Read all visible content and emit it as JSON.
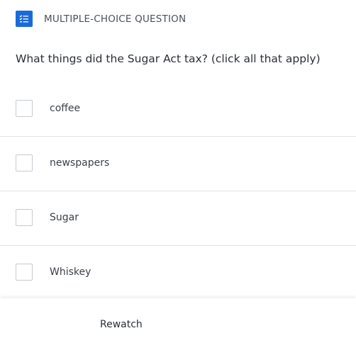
{
  "header": {
    "type_label": "MULTIPLE-CHOICE QUESTION",
    "icon": "checklist-icon",
    "accent_color": "#1a6bd8"
  },
  "question": {
    "text": "What things did the Sugar Act tax? (click all that apply)"
  },
  "options": [
    {
      "label": "coffee",
      "checked": false
    },
    {
      "label": "newspapers",
      "checked": false
    },
    {
      "label": "Sugar",
      "checked": false
    },
    {
      "label": "Whiskey",
      "checked": false
    }
  ],
  "footer": {
    "rewatch_label": "Rewatch"
  }
}
